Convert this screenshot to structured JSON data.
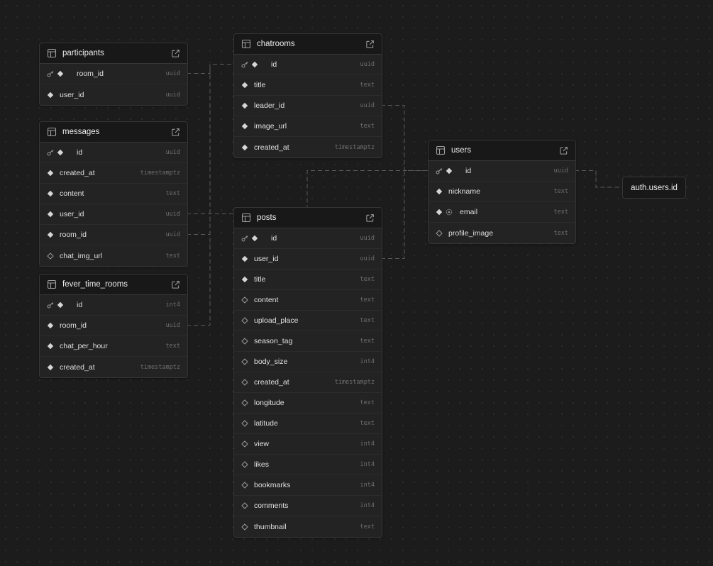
{
  "colors": {
    "background": "#1c1c1c",
    "node_bg": "#232323",
    "header_bg": "#181818",
    "border": "#363636",
    "connector": "#5a5a5a",
    "type_text": "#6e6e6e"
  },
  "tables": [
    {
      "id": "participants",
      "name": "participants",
      "columns": [
        {
          "name": "room_id",
          "type": "uuid",
          "pk": true,
          "nullable": false
        },
        {
          "name": "user_id",
          "type": "uuid",
          "pk": false,
          "nullable": false
        }
      ]
    },
    {
      "id": "messages",
      "name": "messages",
      "columns": [
        {
          "name": "id",
          "type": "uuid",
          "pk": true,
          "nullable": false
        },
        {
          "name": "created_at",
          "type": "timestamptz",
          "pk": false,
          "nullable": false
        },
        {
          "name": "content",
          "type": "text",
          "pk": false,
          "nullable": false
        },
        {
          "name": "user_id",
          "type": "uuid",
          "pk": false,
          "nullable": false
        },
        {
          "name": "room_id",
          "type": "uuid",
          "pk": false,
          "nullable": false
        },
        {
          "name": "chat_img_url",
          "type": "text",
          "pk": false,
          "nullable": true
        }
      ]
    },
    {
      "id": "fever_time_rooms",
      "name": "fever_time_rooms",
      "columns": [
        {
          "name": "id",
          "type": "int4",
          "pk": true,
          "nullable": false
        },
        {
          "name": "room_id",
          "type": "uuid",
          "pk": false,
          "nullable": false
        },
        {
          "name": "chat_per_hour",
          "type": "text",
          "pk": false,
          "nullable": false
        },
        {
          "name": "created_at",
          "type": "timestamptz",
          "pk": false,
          "nullable": false
        }
      ]
    },
    {
      "id": "chatrooms",
      "name": "chatrooms",
      "columns": [
        {
          "name": "id",
          "type": "uuid",
          "pk": true,
          "nullable": false
        },
        {
          "name": "title",
          "type": "text",
          "pk": false,
          "nullable": false
        },
        {
          "name": "leader_id",
          "type": "uuid",
          "pk": false,
          "nullable": false
        },
        {
          "name": "image_url",
          "type": "text",
          "pk": false,
          "nullable": false
        },
        {
          "name": "created_at",
          "type": "timestamptz",
          "pk": false,
          "nullable": false
        }
      ]
    },
    {
      "id": "posts",
      "name": "posts",
      "columns": [
        {
          "name": "id",
          "type": "uuid",
          "pk": true,
          "nullable": false
        },
        {
          "name": "user_id",
          "type": "uuid",
          "pk": false,
          "nullable": false
        },
        {
          "name": "title",
          "type": "text",
          "pk": false,
          "nullable": false
        },
        {
          "name": "content",
          "type": "text",
          "pk": false,
          "nullable": true
        },
        {
          "name": "upload_place",
          "type": "text",
          "pk": false,
          "nullable": true
        },
        {
          "name": "season_tag",
          "type": "text",
          "pk": false,
          "nullable": true
        },
        {
          "name": "body_size",
          "type": "int4",
          "pk": false,
          "nullable": true
        },
        {
          "name": "created_at",
          "type": "timestamptz",
          "pk": false,
          "nullable": true
        },
        {
          "name": "longitude",
          "type": "text",
          "pk": false,
          "nullable": true
        },
        {
          "name": "latitude",
          "type": "text",
          "pk": false,
          "nullable": true
        },
        {
          "name": "view",
          "type": "int4",
          "pk": false,
          "nullable": true
        },
        {
          "name": "likes",
          "type": "int4",
          "pk": false,
          "nullable": true
        },
        {
          "name": "bookmarks",
          "type": "int4",
          "pk": false,
          "nullable": true
        },
        {
          "name": "comments",
          "type": "int4",
          "pk": false,
          "nullable": true
        },
        {
          "name": "thumbnail",
          "type": "text",
          "pk": false,
          "nullable": true
        }
      ]
    },
    {
      "id": "users",
      "name": "users",
      "columns": [
        {
          "name": "id",
          "type": "uuid",
          "pk": true,
          "nullable": false
        },
        {
          "name": "nickname",
          "type": "text",
          "pk": false,
          "nullable": false
        },
        {
          "name": "email",
          "type": "text",
          "pk": false,
          "nullable": false,
          "unique": true
        },
        {
          "name": "profile_image",
          "type": "text",
          "pk": false,
          "nullable": true
        }
      ]
    }
  ],
  "external_ref": {
    "label": "auth.users.id"
  },
  "relations": [
    {
      "from": "participants.room_id",
      "to": "chatrooms.id"
    },
    {
      "from": "messages.room_id",
      "to": "chatrooms.id"
    },
    {
      "from": "fever_time_rooms.room_id",
      "to": "chatrooms.id"
    },
    {
      "from": "messages.user_id",
      "to": "users.id"
    },
    {
      "from": "chatrooms.leader_id",
      "to": "users.id"
    },
    {
      "from": "posts.user_id",
      "to": "users.id"
    },
    {
      "from": "users.id",
      "to": "auth.users.id"
    }
  ]
}
